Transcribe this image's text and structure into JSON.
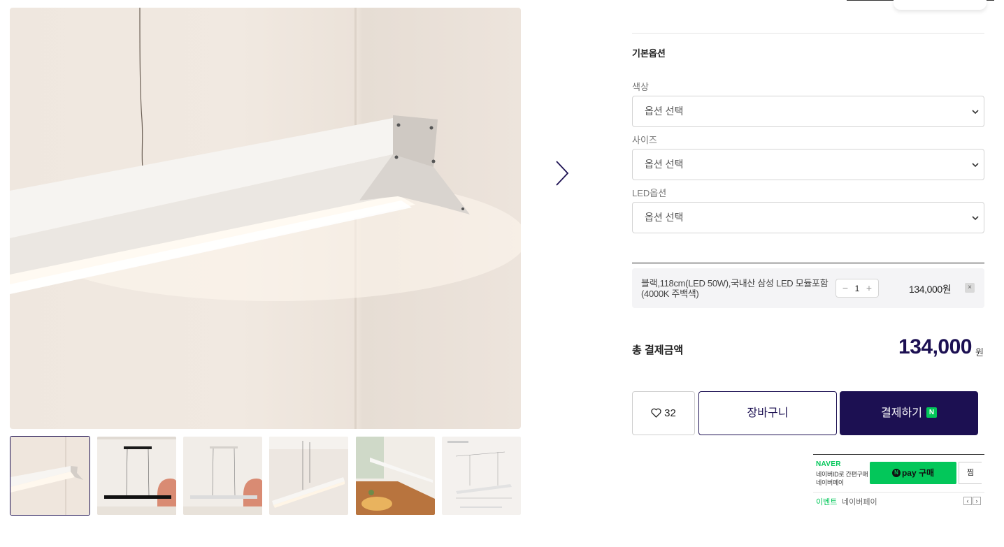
{
  "gallery": {
    "main_image_alt": "",
    "thumbnail_count": 6,
    "active_thumbnail": 1
  },
  "options": {
    "section_title": "기본옵션",
    "fields": [
      {
        "label": "색상",
        "value": "옵션 선택"
      },
      {
        "label": "사이즈",
        "value": "옵션 선택"
      },
      {
        "label": "LED옵션",
        "value": "옵션 선택"
      }
    ]
  },
  "selected_item": {
    "name": "블랙,118cm(LED 50W),국내산 삼성 LED 모듈포함(4000K 주백색)",
    "quantity": "1",
    "price": "134,000원",
    "remove": "×"
  },
  "total": {
    "label": "총 결제금액",
    "amount": "134,000",
    "unit": "원"
  },
  "actions": {
    "like_count": "32",
    "cart_label": "장바구니",
    "buy_label": "결제하기",
    "buy_badge": "N"
  },
  "naver_pay": {
    "brand": "NAVER",
    "desc_line1": "네이버ID로 간편구매",
    "desc_line2": "네이버페이",
    "pay_label": "pay 구매",
    "pay_icon": "N",
    "wish_label": "찜",
    "event_label": "이벤트",
    "event_name": "네이버페이",
    "prev": "‹",
    "next": "›"
  },
  "colors": {
    "brand_navy": "#1c1052",
    "naver_green": "#03c75a"
  }
}
